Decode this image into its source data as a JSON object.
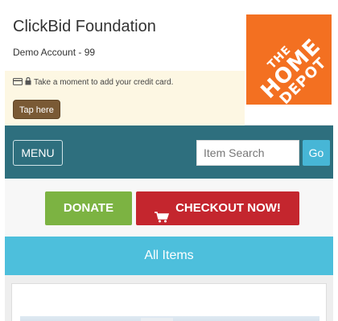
{
  "header": {
    "org_name": "ClickBid Foundation",
    "account": "Demo Account - 99",
    "notice": "Take a moment to add your credit card.",
    "notice_icons": [
      "credit-card-icon",
      "lock-icon"
    ],
    "tap_here": "Tap here"
  },
  "logo": {
    "line1": "THE",
    "line2": "HOME",
    "line3": "DEPOT",
    "brand_color": "#f37021"
  },
  "nav": {
    "menu_label": "MENU",
    "search_placeholder": "Item Search",
    "go_label": "Go"
  },
  "actions": {
    "donate_label": "DONATE",
    "checkout_label": "CHECKOUT NOW!",
    "checkout_icon": "shopping-cart-icon"
  },
  "list": {
    "heading": "All Items"
  },
  "colors": {
    "nav_bg": "#2e6f7e",
    "donate": "#7cb342",
    "checkout": "#c4262e",
    "all_items": "#4dbfdc",
    "go": "#47b6d6",
    "tap_btn": "#7a5a35"
  }
}
